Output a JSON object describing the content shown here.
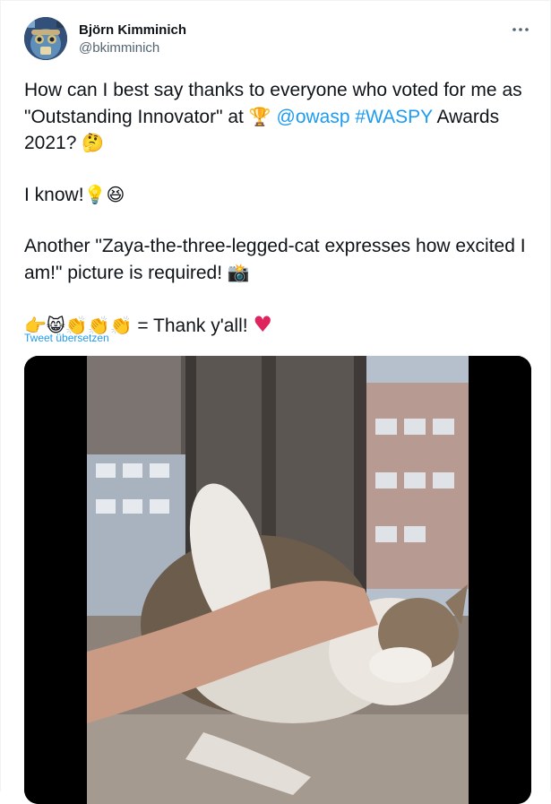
{
  "tweet": {
    "author": {
      "display_name": "Björn Kimminich",
      "handle": "@bkimminich",
      "avatar_icon": "user-avatar"
    },
    "more_icon": "more-dots-icon",
    "line1": {
      "t1": "How can I best say thanks to everyone who voted for me as \"Outstanding Innovator\" at",
      "emoji_trophy": "🏆",
      "mention": "@owasp",
      "hashtag": "#WASPY",
      "t2": "Awards 2021?",
      "emoji_thinking": "🤔"
    },
    "line2": {
      "t1": "I know!",
      "emoji_bulb": "💡",
      "emoji_laugh": "😆"
    },
    "line3": {
      "t1": "Another \"Zaya-the-three-legged-cat expresses how excited I am!\" picture is required!",
      "emoji_camera": "📸"
    },
    "line4": {
      "emojis": "👉😸👏👏👏",
      "t1": "= Thank y'all!",
      "emoji_heart": "♥"
    },
    "translate_label": "Tweet übersetzen",
    "media": {
      "type": "photo",
      "subject": "cat-photo"
    }
  },
  "colors": {
    "link": "#1d9bf0",
    "text": "#0f1419",
    "secondary": "#536471",
    "heart": "#e0245e"
  }
}
